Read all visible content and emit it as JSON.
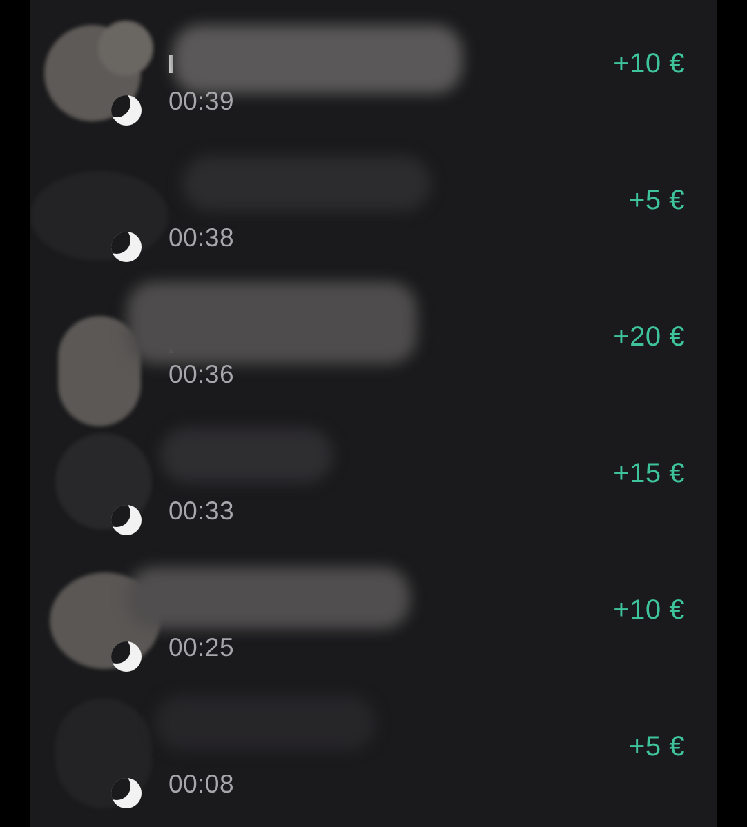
{
  "colors": {
    "background": "#1a1a1c",
    "amount_positive": "#3ec39b",
    "time_text": "#a6a6ab"
  },
  "transactions": [
    {
      "time": "00:39",
      "amount": "+10 €"
    },
    {
      "time": "00:38",
      "amount": "+5 €"
    },
    {
      "time": "00:36",
      "amount": "+20 €"
    },
    {
      "time": "00:33",
      "amount": "+15 €"
    },
    {
      "time": "00:25",
      "amount": "+10 €"
    },
    {
      "time": "00:08",
      "amount": "+5 €"
    }
  ]
}
